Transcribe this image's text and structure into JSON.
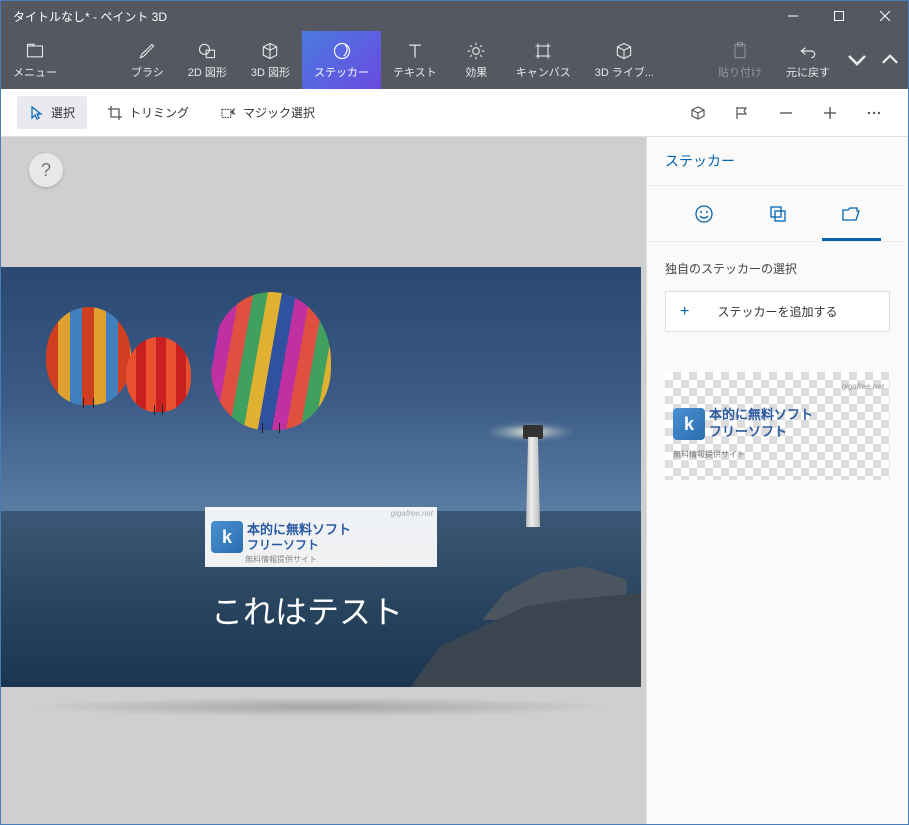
{
  "window": {
    "title": "タイトルなし* - ペイント 3D"
  },
  "toolbar": {
    "menu": "メニュー",
    "brushes": "ブラシ",
    "shapes2d": "2D 図形",
    "shapes3d": "3D 図形",
    "stickers": "ステッカー",
    "text": "テキスト",
    "effects": "効果",
    "canvas": "キャンバス",
    "library3d": "3D ライブ...",
    "paste": "貼り付け",
    "undo": "元に戻す"
  },
  "subbar": {
    "select": "選択",
    "crop": "トリミング",
    "magicselect": "マジック選択"
  },
  "sidepanel": {
    "title": "ステッカー",
    "section_label": "独自のステッカーの選択",
    "add_label": "ステッカーを追加する"
  },
  "sticker": {
    "line1": "本的に無料ソフト",
    "line2": "フリーソフト",
    "sub": "無料情報提供サイト",
    "url": "gigafree.net",
    "icon_letter": "k"
  },
  "canvas": {
    "text": "これはテスト",
    "help": "?"
  }
}
